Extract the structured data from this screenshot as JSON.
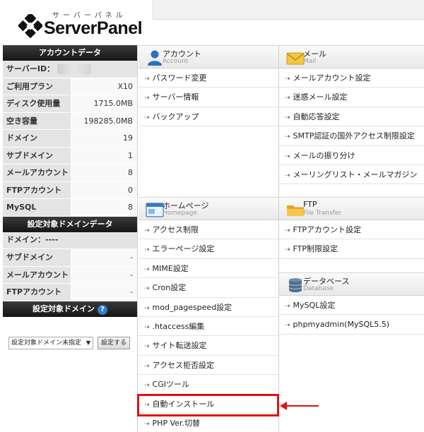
{
  "brand": {
    "kana": "サーバーパネル",
    "name": "ServerPanel"
  },
  "account_data": {
    "title": "アカウントデータ",
    "server_id_label": "サーバーID：",
    "rows": [
      {
        "label": "ご利用プラン",
        "value": "X10"
      },
      {
        "label": "ディスク使用量",
        "value": "1715.0MB"
      },
      {
        "label": "空き容量",
        "value": "198285.0MB"
      },
      {
        "label": "ドメイン",
        "value": "19"
      },
      {
        "label": "サブドメイン",
        "value": "1"
      },
      {
        "label": "メールアカウント",
        "value": "8"
      },
      {
        "label": "FTPアカウント",
        "value": "0"
      },
      {
        "label": "MySQL",
        "value": "8"
      }
    ]
  },
  "domain_data": {
    "title": "設定対象ドメインデータ",
    "domain_label": "ドメイン：----",
    "rows": [
      {
        "label": "サブドメイン",
        "value": "-"
      },
      {
        "label": "メールアカウント",
        "value": "-"
      },
      {
        "label": "FTPアカウント",
        "value": "-"
      }
    ]
  },
  "domain_select": {
    "title": "設定対象ドメイン",
    "help_icon": "?",
    "selected": "設定対象ドメイン未指定",
    "button": "設定する"
  },
  "panels": {
    "account": {
      "title": "アカウント",
      "subtitle": "Account",
      "items": [
        "パスワード変更",
        "サーバー情報",
        "バックアップ"
      ]
    },
    "mail": {
      "title": "メール",
      "subtitle": "Mail",
      "items": [
        "メールアカウント設定",
        "迷惑メール設定",
        "自動応答設定",
        "SMTP認証の国外アクセス制限設定",
        "メールの振り分け",
        "メーリングリスト・メールマガジン"
      ]
    },
    "homepage": {
      "title": "ホームページ",
      "subtitle": "Homepage",
      "items": [
        "アクセス制限",
        "エラーページ設定",
        "MIME設定",
        "Cron設定",
        "mod_pagespeed設定",
        ".htaccess編集",
        "サイト転送設定",
        "アクセス拒否設定",
        "CGIツール",
        "自動インストール",
        "PHP Ver.切替"
      ]
    },
    "ftp": {
      "title": "FTP",
      "subtitle": "File Transfer",
      "items": [
        "FTPアカウント設定",
        "FTP制限設定"
      ]
    },
    "database": {
      "title": "データベース",
      "subtitle": "Database",
      "items": [
        "MySQL設定",
        "phpmyadmin(MySQL5.5)"
      ]
    }
  },
  "bullet": "⇢",
  "colors": {
    "highlight": "#e01010",
    "help_icon": "#2f7fd0",
    "sidebar_header": "#1e1e1e"
  }
}
